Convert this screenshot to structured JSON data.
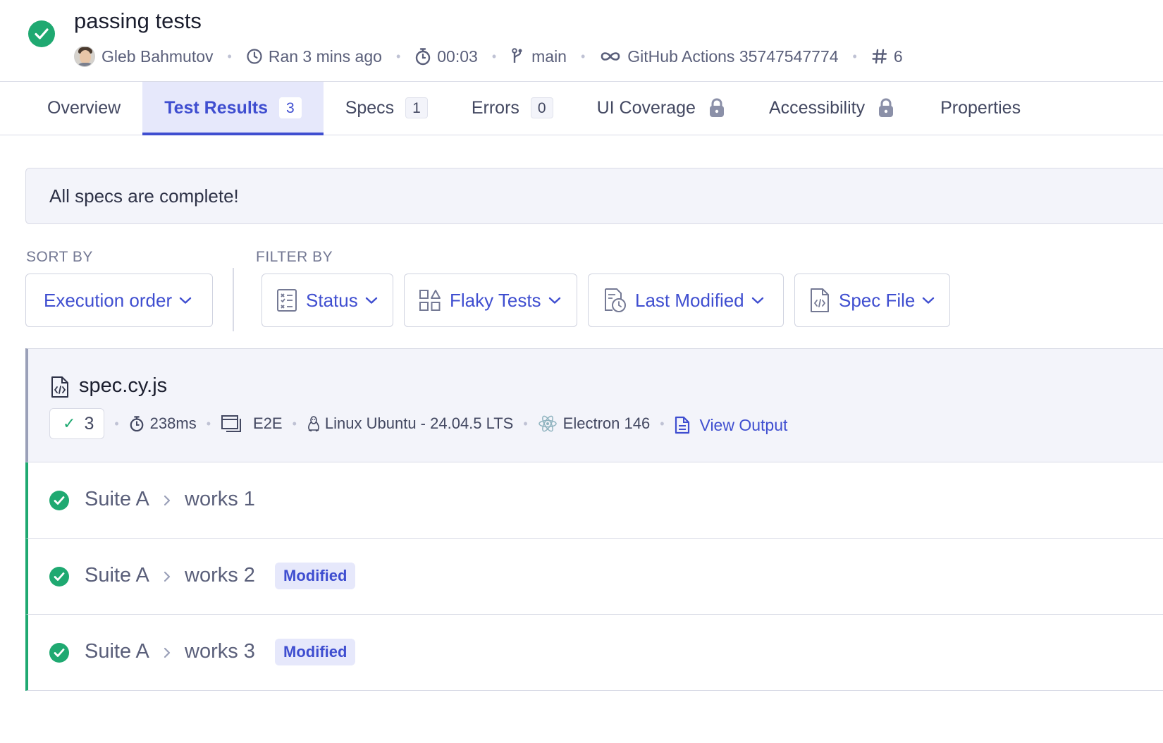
{
  "run": {
    "title": "passing tests",
    "author": "Gleb Bahmutov",
    "ran": "Ran 3 mins ago",
    "duration": "00:03",
    "branch": "main",
    "ci": "GitHub Actions 35747547774",
    "run_number": "6",
    "status_color": "#1fa971"
  },
  "tabs": [
    {
      "label": "Overview",
      "count": null
    },
    {
      "label": "Test Results",
      "count": "3",
      "active": true
    },
    {
      "label": "Specs",
      "count": "1"
    },
    {
      "label": "Errors",
      "count": "0"
    },
    {
      "label": "UI Coverage",
      "icon": "lock-icon"
    },
    {
      "label": "Accessibility",
      "icon": "lock-icon"
    },
    {
      "label": "Properties",
      "count": null
    }
  ],
  "banner": "All specs are complete!",
  "sort": {
    "label": "SORT BY",
    "value": "Execution order"
  },
  "filter": {
    "label": "FILTER BY",
    "items": [
      "Status",
      "Flaky Tests",
      "Last Modified",
      "Spec File"
    ]
  },
  "spec": {
    "name": "spec.cy.js",
    "passed": "3",
    "duration": "238ms",
    "testing_type": "E2E",
    "os": "Linux Ubuntu - 24.04.5 LTS",
    "browser": "Electron 146",
    "view_output": "View Output"
  },
  "tests": [
    {
      "suite": "Suite A",
      "name": "works 1",
      "badge": ""
    },
    {
      "suite": "Suite A",
      "name": "works 2",
      "badge": "Modified"
    },
    {
      "suite": "Suite A",
      "name": "works 3",
      "badge": "Modified"
    }
  ],
  "colors": {
    "accent": "#3f4ed0",
    "pass": "#1fa971",
    "accent_bg": "#e6e8fb"
  }
}
